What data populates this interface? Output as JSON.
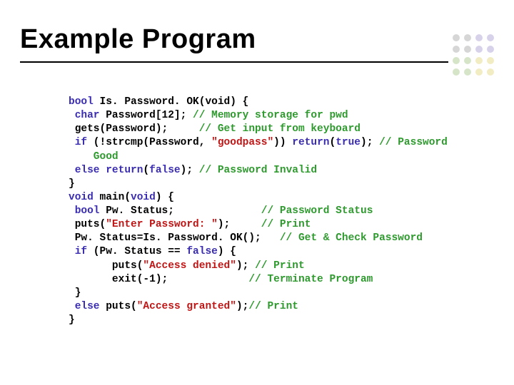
{
  "title": "Example Program",
  "code": {
    "l1_kw": "bool",
    "l1_rest": " Is. Password. OK(void) {",
    "l2_kw": " char",
    "l2_mid": " Password[12]; ",
    "l2_cm": "// Memory storage for pwd",
    "l3_mid": " gets(Password);     ",
    "l3_cm": "// Get input from keyboard",
    "l4_kw": " if",
    "l4_mid1": " (!strcmp(Password, ",
    "l4_str": "\"goodpass\"",
    "l4_mid2": ")) ",
    "l4_kw2": "return",
    "l4_mid3": "(",
    "l4_kw3": "true",
    "l4_mid4": "); ",
    "l4_cm": "// Password",
    "l4b_cm": "    Good",
    "l5_kw": " else return",
    "l5_mid": "(",
    "l5_kw2": "false",
    "l5_mid2": "); ",
    "l5_cm": "// Password Invalid",
    "l6": "}",
    "l7_kw": "void",
    "l7_mid": " main(",
    "l7_kw2": "void",
    "l7_mid2": ") {",
    "l8_kw": " bool",
    "l8_mid": " Pw. Status;              ",
    "l8_cm": "// Password Status",
    "l9_mid1": " puts(",
    "l9_str": "\"Enter Password: \"",
    "l9_mid2": ");     ",
    "l9_cm": "// Print",
    "l10_mid": " Pw. Status=Is. Password. OK();   ",
    "l10_cm": "// Get & Check Password",
    "l11_kw": " if",
    "l11_mid": " (Pw. Status == ",
    "l11_kw2": "false",
    "l11_mid2": ") {",
    "l12_mid1": "       puts(",
    "l12_str": "\"Access denied\"",
    "l12_mid2": "); ",
    "l12_cm": "// Print",
    "l13_mid": "       exit(-1);             ",
    "l13_cm": "// Terminate Program",
    "l14": " }",
    "l15_kw": " else",
    "l15_mid1": " puts(",
    "l15_str": "\"Access granted\"",
    "l15_mid2": ");",
    "l15_cm": "// Print",
    "l16": "}"
  }
}
